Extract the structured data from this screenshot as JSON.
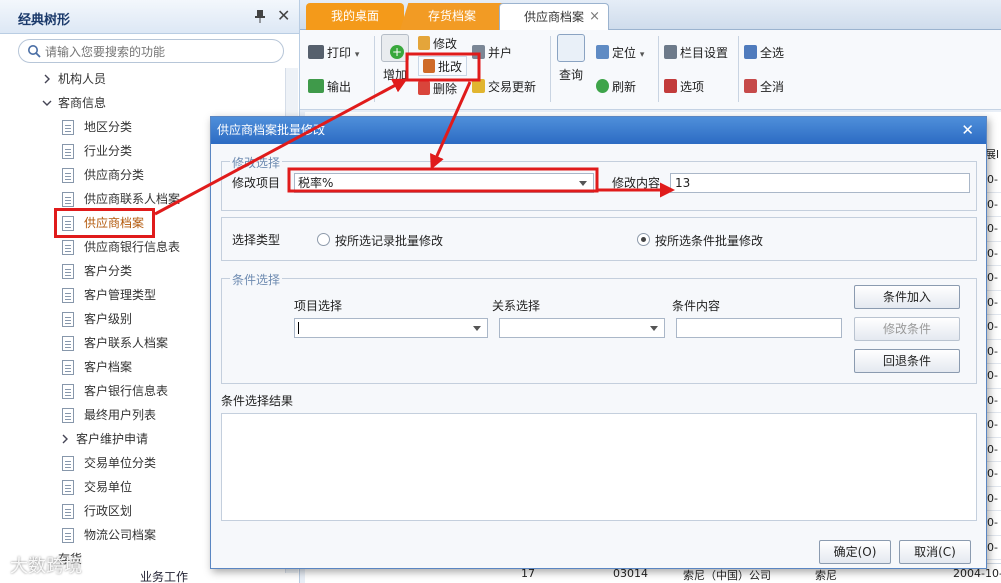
{
  "left_panel": {
    "title": "经典树形",
    "search_placeholder": "请输入您要搜索的功能",
    "items": [
      {
        "label": "机构人员",
        "kind": "group-collapsed"
      },
      {
        "label": "客商信息",
        "kind": "group-open"
      },
      {
        "label": "地区分类",
        "kind": "leaf"
      },
      {
        "label": "行业分类",
        "kind": "leaf"
      },
      {
        "label": "供应商分类",
        "kind": "leaf"
      },
      {
        "label": "供应商联系人档案",
        "kind": "leaf"
      },
      {
        "label": "供应商档案",
        "kind": "leaf-selected"
      },
      {
        "label": "供应商银行信息表",
        "kind": "leaf"
      },
      {
        "label": "客户分类",
        "kind": "leaf"
      },
      {
        "label": "客户管理类型",
        "kind": "leaf"
      },
      {
        "label": "客户级别",
        "kind": "leaf"
      },
      {
        "label": "客户联系人档案",
        "kind": "leaf"
      },
      {
        "label": "客户档案",
        "kind": "leaf"
      },
      {
        "label": "客户银行信息表",
        "kind": "leaf"
      },
      {
        "label": "最终用户列表",
        "kind": "leaf"
      },
      {
        "label": "客户维护申请",
        "kind": "group-collapsed"
      },
      {
        "label": "交易单位分类",
        "kind": "leaf"
      },
      {
        "label": "交易单位",
        "kind": "leaf"
      },
      {
        "label": "行政区划",
        "kind": "leaf"
      },
      {
        "label": "物流公司档案",
        "kind": "leaf"
      }
    ],
    "bottom_partial": "存货",
    "bottom_group": "业务工作"
  },
  "tabs": [
    {
      "label": "我的桌面"
    },
    {
      "label": "存货档案"
    },
    {
      "label": "供应商档案",
      "close": "×"
    }
  ],
  "toolbar": {
    "print": "打印",
    "output": "输出",
    "add": "增加",
    "modify": "修改",
    "batch_modify": "批改",
    "delete": "删除",
    "merge": "并户",
    "trade_update": "交易更新",
    "query": "查询",
    "locate": "定位",
    "refresh": "刷新",
    "column_settings": "栏目设置",
    "options": "选项",
    "select_all": "全选",
    "deselect_all": "全消"
  },
  "grid_peek": {
    "header_fragment": "展l",
    "cells": [
      "0-",
      "0-",
      "0-",
      "0-",
      "0-",
      "0-",
      "0-",
      "0-",
      "0-",
      "0-",
      "0-",
      "0-",
      "0-",
      "0-",
      "0-",
      "0-",
      "0-"
    ],
    "bottom_row": [
      "17",
      "03014",
      "索尼（中国）公司",
      "索尼",
      "2004-10-"
    ]
  },
  "dialog": {
    "title": "供应商档案批量修改",
    "modify_group": {
      "legend": "修改选择",
      "item_label": "修改项目",
      "item_value": "税率%",
      "content_label": "修改内容",
      "content_value": "13"
    },
    "select_type": {
      "label": "选择类型",
      "option_selected_records": "按所选记录批量修改",
      "option_conditions": "按所选条件批量修改",
      "selected": "conditions"
    },
    "condition_group": {
      "legend": "条件选择",
      "col_item": "项目选择",
      "col_relation": "关系选择",
      "col_content": "条件内容",
      "btn_add": "条件加入",
      "btn_modify": "修改条件",
      "btn_revert": "回退条件"
    },
    "result_label": "条件选择结果",
    "ok": "确定(O)",
    "cancel": "取消(C)"
  },
  "watermark": "大数跨境"
}
